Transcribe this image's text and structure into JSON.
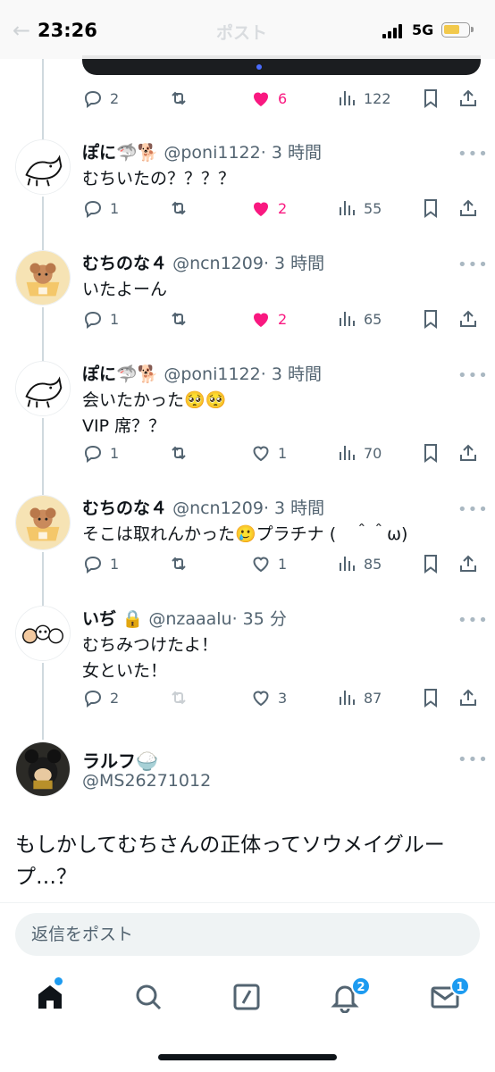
{
  "status_bar": {
    "time": "23:26",
    "network": "5G",
    "title": "ポスト"
  },
  "colors": {
    "like": "#f91880",
    "accent": "#1d9bf0",
    "muted": "#536471"
  },
  "posts": [
    {
      "name": "ぽに🦈🐕",
      "handle": "@poni1122",
      "time": "· 3 時間",
      "lines": [
        "むちいたの？？？？"
      ],
      "replies": "1",
      "likes": "2",
      "liked": true,
      "views": "55"
    },
    {
      "name": "むちのな４",
      "handle": "@ncn1209",
      "time": "· 3 時間",
      "lines": [
        "いたよーん"
      ],
      "replies": "1",
      "likes": "2",
      "liked": true,
      "views": "65"
    },
    {
      "name": "ぽに🦈🐕",
      "handle": "@poni1122",
      "time": "· 3 時間",
      "lines": [
        "会いたかった🥺🥺",
        "VIP 席？？"
      ],
      "replies": "1",
      "likes": "1",
      "liked": false,
      "views": "70"
    },
    {
      "name": "むちのな４",
      "handle": "@ncn1209",
      "time": "· 3 時間",
      "lines": [
        "そこは取れんかった🥲プラチナ (　＾＾ω)"
      ],
      "replies": "1",
      "likes": "1",
      "liked": false,
      "views": "85"
    },
    {
      "name": "いぢ 🔒",
      "handle": "@nzaaalu",
      "time": "· 35 分",
      "lines": [
        "むちみつけたよ！",
        "女といた！"
      ],
      "replies": "2",
      "likes": "3",
      "liked": false,
      "views": "87"
    }
  ],
  "top_post_actions": {
    "replies": "2",
    "likes": "6",
    "liked": true,
    "views": "122"
  },
  "focused_post": {
    "name": "ラルフ🍚",
    "handle": "@MS26271012",
    "text": "もしかしてむちさんの正体ってソウメイグループ…？"
  },
  "reply_bar": {
    "placeholder": "返信をポスト"
  },
  "tab_bar": {
    "notifications_badge": "2",
    "messages_badge": "1"
  },
  "icons": [
    "reply-icon",
    "repost-icon",
    "like-icon",
    "views-icon",
    "bookmark-icon",
    "share-icon",
    "home-icon",
    "search-icon",
    "grok-icon",
    "bell-icon",
    "mail-icon"
  ]
}
